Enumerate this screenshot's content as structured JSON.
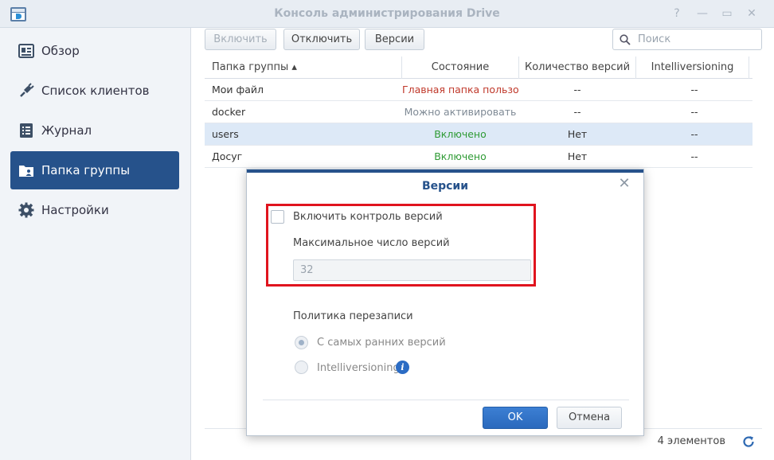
{
  "window": {
    "title": "Консоль администрирования Drive",
    "controls": [
      "?",
      "—",
      "▭",
      "✕"
    ]
  },
  "sidebar": {
    "items": [
      {
        "label": "Обзор",
        "icon": "overview-icon"
      },
      {
        "label": "Список клиентов",
        "icon": "plug-icon"
      },
      {
        "label": "Журнал",
        "icon": "log-icon"
      },
      {
        "label": "Папка группы",
        "icon": "team-folder-icon",
        "active": true
      },
      {
        "label": "Настройки",
        "icon": "gear-icon"
      }
    ]
  },
  "toolbar": {
    "enable_label": "Включить",
    "disable_label": "Отключить",
    "versions_label": "Версии",
    "search_placeholder": "Поиск"
  },
  "table": {
    "headers": [
      "Папка группы ▴",
      "Состояние",
      "Количество версий",
      "Intelliversioning"
    ],
    "rows": [
      {
        "name": "Мои файл",
        "state": "Главная папка пользо...",
        "versions": "--",
        "intelli": "--"
      },
      {
        "name": "docker",
        "state": "Можно активировать",
        "versions": "--",
        "intelli": "--"
      },
      {
        "name": "users",
        "state": "Включено",
        "versions": "Нет",
        "intelli": "--"
      },
      {
        "name": "Досуг",
        "state": "Включено",
        "versions": "Нет",
        "intelli": "--"
      }
    ]
  },
  "footer": {
    "count": "4 элементов"
  },
  "dialog": {
    "title": "Версии",
    "enable_versioning_label": "Включить контроль версий",
    "max_versions_label": "Максимальное число версий",
    "max_versions_value": "32",
    "policy_label": "Политика перезаписи",
    "policy_options": [
      "С самых ранних версий",
      "Intelliversioning"
    ],
    "info_glyph": "i",
    "ok_label": "OK",
    "cancel_label": "Отмена"
  },
  "colors": {
    "accent": "#26528b",
    "highlight_box": "#e0141e",
    "status_green": "#2f9b35",
    "status_red": "#c0392b"
  }
}
